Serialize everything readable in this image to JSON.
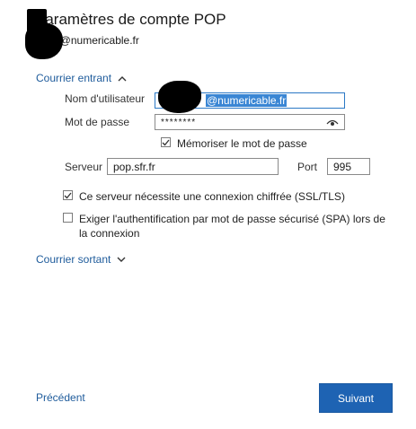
{
  "header": {
    "title": "Paramètres de compte POP",
    "email_suffix": "@numericable.fr",
    "email_partial": "a@numericable.fr"
  },
  "incoming": {
    "section_label": "Courrier entrant",
    "username_label": "Nom d'utilisateur",
    "username_value_visible": "@numericable.fr",
    "password_label": "Mot de passe",
    "password_value": "********",
    "remember_label": "Mémoriser le mot de passe",
    "remember_checked": true,
    "server_label": "Serveur",
    "server_value": "pop.sfr.fr",
    "port_label": "Port",
    "port_value": "995",
    "ssl_label": "Ce serveur nécessite une connexion chiffrée (SSL/TLS)",
    "ssl_checked": true,
    "spa_label_line1": "Exiger l'authentification par mot de passe sécurisé (SPA) lors de",
    "spa_label_line2": "la connexion",
    "spa_checked": false
  },
  "outgoing": {
    "section_label": "Courrier sortant"
  },
  "footer": {
    "previous_label": "Précédent",
    "next_label": "Suivant"
  },
  "colors": {
    "accent": "#1e63b3",
    "link": "#1e5b9b",
    "selection": "#3a86d4"
  }
}
